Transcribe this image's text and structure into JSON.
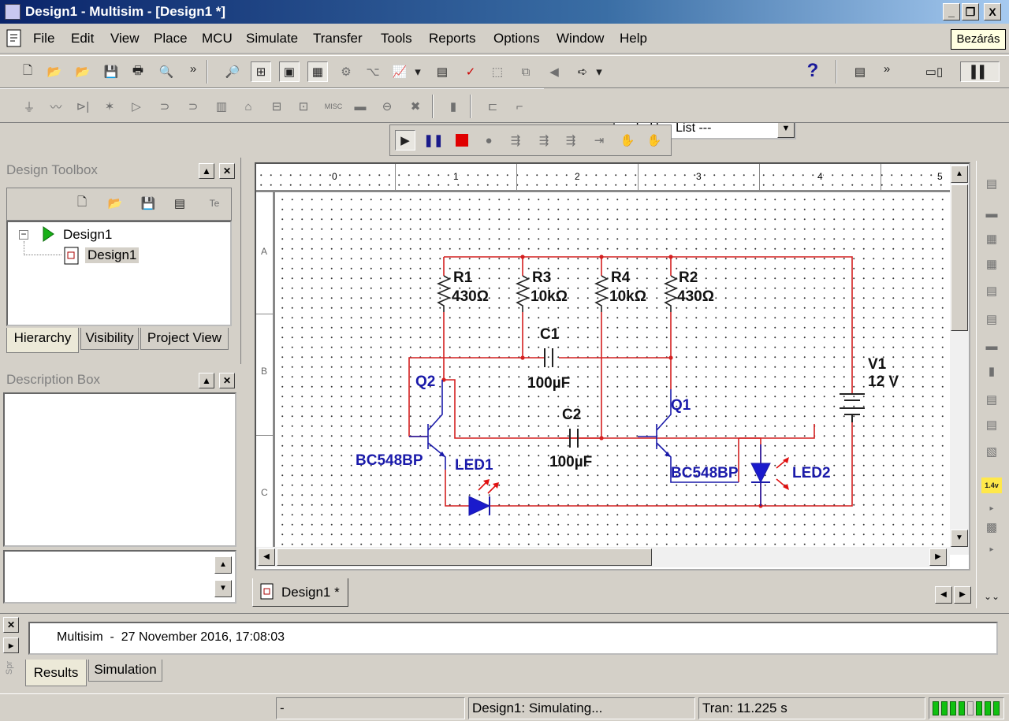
{
  "window": {
    "title": "Design1 - Multisim - [Design1 *]",
    "controls": {
      "minimize": "_",
      "restore": "❐",
      "close": "X"
    }
  },
  "menu": {
    "items": [
      "File",
      "Edit",
      "View",
      "Place",
      "MCU",
      "Simulate",
      "Transfer",
      "Tools",
      "Reports",
      "Options",
      "Window",
      "Help"
    ],
    "tooltip": "Bezárás"
  },
  "toolbar": {
    "in_use_list": "--- In Use List ---",
    "help_glyph": "?",
    "more_glyph": "»",
    "misc_label": "MISC"
  },
  "design_toolbox": {
    "title": "Design Toolbox",
    "tree": {
      "root": "Design1",
      "child": "Design1"
    },
    "tabs": [
      "Hierarchy",
      "Visibility",
      "Project View"
    ]
  },
  "description_box": {
    "title": "Description Box"
  },
  "canvas": {
    "ruler_top": [
      "0",
      "1",
      "2",
      "3",
      "4",
      "5"
    ],
    "ruler_left": [
      "A",
      "B",
      "C"
    ],
    "tab_label": "Design1 *"
  },
  "circuit": {
    "components": {
      "R1": {
        "ref": "R1",
        "value": "430Ω"
      },
      "R2": {
        "ref": "R2",
        "value": "430Ω"
      },
      "R3": {
        "ref": "R3",
        "value": "10kΩ"
      },
      "R4": {
        "ref": "R4",
        "value": "10kΩ"
      },
      "C1": {
        "ref": "C1",
        "value": "100µF"
      },
      "C2": {
        "ref": "C2",
        "value": "100µF"
      },
      "Q1": {
        "ref": "Q1",
        "model": "BC548BP"
      },
      "Q2": {
        "ref": "Q2",
        "model": "BC548BP"
      },
      "LED1": {
        "ref": "LED1"
      },
      "LED2": {
        "ref": "LED2"
      },
      "V1": {
        "ref": "V1",
        "value": "12 V"
      }
    },
    "colors": {
      "wire": "#d42020",
      "component_blue": "#1a1aaa",
      "label_dark": "#111111"
    }
  },
  "results": {
    "log_line": "Multisim  -  27 November 2016, 17:08:03",
    "tabs": [
      "Results",
      "Simulation"
    ],
    "side_label": "Spr"
  },
  "status": {
    "cell1": "-",
    "cell2": "Design1: Simulating...",
    "cell3": "Tran: 11.225 s"
  }
}
